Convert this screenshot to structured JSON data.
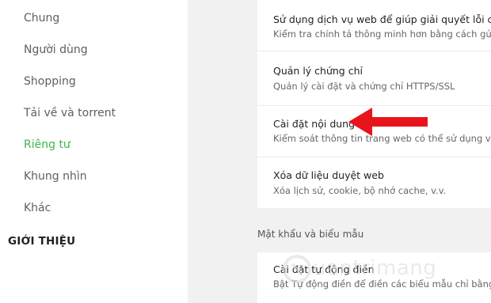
{
  "sidebar": {
    "items": [
      {
        "label": "Chung"
      },
      {
        "label": "Người dùng"
      },
      {
        "label": "Shopping"
      },
      {
        "label": "Tải về và torrent"
      },
      {
        "label": "Riêng tư"
      },
      {
        "label": "Khung nhìn"
      },
      {
        "label": "Khác"
      }
    ],
    "about_heading": "GIỚI THIỆU",
    "active_color": "#3cb54a"
  },
  "privacy_card": {
    "rows": [
      {
        "title": "Sử dụng dịch vụ web để giúp giải quyết lỗi chính",
        "subtitle": "Kiểm tra chính tả thông minh hơn bằng cách gửi"
      },
      {
        "title": "Quản lý chứng chỉ",
        "subtitle": "Quản lý cài đặt và chứng chỉ HTTPS/SSL"
      },
      {
        "title": "Cài đặt nội dung",
        "subtitle": "Kiểm soát thông tin trang web có thể sử dụng và"
      },
      {
        "title": "Xóa dữ liệu duyệt web",
        "subtitle": "Xóa lịch sử, cookie, bộ nhớ cache, v.v."
      }
    ]
  },
  "passwords_section": {
    "heading": "Mật khẩu và biểu mẫu",
    "rows": [
      {
        "title": "Cài đặt tự động điền",
        "subtitle": "Bật Tự động điền để điền các biểu mẫu chỉ bằng"
      }
    ]
  },
  "annotation": {
    "arrow_color": "#e8141b",
    "arrow_direction": "left"
  },
  "watermark": {
    "text": "uantrimang",
    "icon": "watermark-logo-icon"
  }
}
